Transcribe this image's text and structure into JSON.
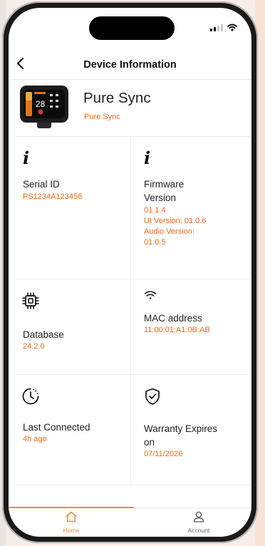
{
  "header": {
    "title": "Device Information"
  },
  "device": {
    "name": "Pure Sync",
    "subtitle": "Pure Sync",
    "thumb_temp": "28"
  },
  "cards": {
    "serial": {
      "label": "Serial ID",
      "value": "PS1234A123456"
    },
    "firmware": {
      "label_line1": "Firmware",
      "label_line2": "Version",
      "v1": "01.1.4",
      "v2": "UI Version: 01.0.6",
      "v3": "Audio Version:",
      "v4": "01.0.5"
    },
    "database": {
      "label": "Database",
      "value": "24.2.0"
    },
    "mac": {
      "label": "MAC address",
      "value": "11:00:01:A1:0B:AB"
    },
    "last_connected": {
      "label": "Last Connected",
      "value": "4h ago"
    },
    "warranty": {
      "label_line1": "Warranty Expires",
      "label_line2": "on",
      "value": "07/11/2026"
    }
  },
  "info_glyph": "i",
  "tabs": {
    "home": "Home",
    "account": "Account"
  },
  "colors": {
    "accent": "#e8691c",
    "tab_active": "#f08a3c",
    "text": "#222222"
  }
}
